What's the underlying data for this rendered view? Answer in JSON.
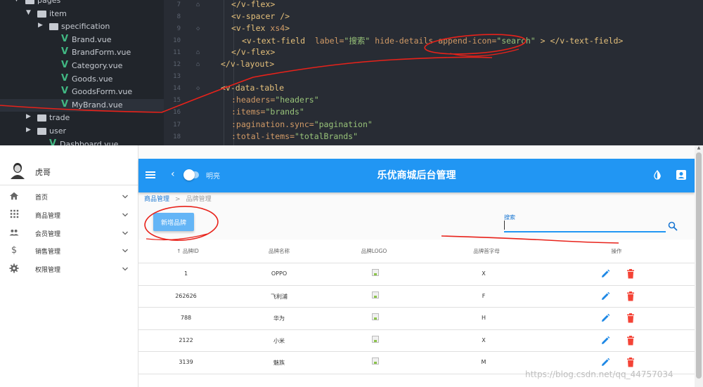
{
  "ide": {
    "tree": [
      {
        "type": "folder",
        "label": "pages",
        "open": true,
        "level": 0
      },
      {
        "type": "folder",
        "label": "item",
        "open": true,
        "level": 1
      },
      {
        "type": "folder",
        "label": "specification",
        "open": false,
        "level": 2
      },
      {
        "type": "file",
        "label": "Brand.vue",
        "level": 2
      },
      {
        "type": "file",
        "label": "BrandForm.vue",
        "level": 2
      },
      {
        "type": "file",
        "label": "Category.vue",
        "level": 2
      },
      {
        "type": "file",
        "label": "Goods.vue",
        "level": 2
      },
      {
        "type": "file",
        "label": "GoodsForm.vue",
        "level": 2
      },
      {
        "type": "file",
        "label": "MyBrand.vue",
        "level": 2,
        "selected": true
      },
      {
        "type": "folder",
        "label": "trade",
        "open": false,
        "level": 1
      },
      {
        "type": "folder",
        "label": "user",
        "open": false,
        "level": 1
      },
      {
        "type": "file",
        "label": "Dashboard.vue",
        "level": 1
      }
    ],
    "line_numbers": [
      "7",
      "8",
      "9",
      "10",
      "11",
      "12",
      "13",
      "14",
      "15",
      "16",
      "17",
      "18"
    ],
    "code": [
      {
        "indent": 1,
        "tokens": [
          [
            "tag",
            "</v-flex>"
          ]
        ]
      },
      {
        "indent": 1,
        "tokens": [
          [
            "tag",
            "<v-spacer />"
          ]
        ]
      },
      {
        "indent": 1,
        "tokens": [
          [
            "tag",
            "<v-flex"
          ],
          [
            "attr",
            " xs4"
          ],
          [
            "tag",
            ">"
          ]
        ]
      },
      {
        "indent": 2,
        "tokens": [
          [
            "tag",
            "<v-text-field"
          ],
          [
            "attr",
            "  label="
          ],
          [
            "str",
            "\"搜索\""
          ],
          [
            "attr",
            " hide-details append-icon="
          ],
          [
            "str",
            "\"search\""
          ],
          [
            "tag",
            " > </v-text-field>"
          ]
        ]
      },
      {
        "indent": 1,
        "tokens": [
          [
            "tag",
            "</v-flex>"
          ]
        ]
      },
      {
        "indent": 0,
        "tokens": [
          [
            "tag",
            "</v-layout>"
          ]
        ]
      },
      {
        "indent": 0,
        "tokens": []
      },
      {
        "indent": 0,
        "tokens": [
          [
            "tag",
            "<v-data-table"
          ]
        ]
      },
      {
        "indent": 1,
        "tokens": [
          [
            "attr",
            ":headers="
          ],
          [
            "str",
            "\"headers\""
          ]
        ]
      },
      {
        "indent": 1,
        "tokens": [
          [
            "attr",
            ":items="
          ],
          [
            "str",
            "\"brands\""
          ]
        ]
      },
      {
        "indent": 1,
        "tokens": [
          [
            "attr",
            ":pagination.sync="
          ],
          [
            "str",
            "\"pagination\""
          ]
        ]
      },
      {
        "indent": 1,
        "tokens": [
          [
            "attr",
            ":total-items="
          ],
          [
            "str",
            "\"totalBrands\""
          ]
        ]
      }
    ]
  },
  "app": {
    "user_name": "虎哥",
    "nav": [
      {
        "label": "首页",
        "icon": "home-icon"
      },
      {
        "label": "商品管理",
        "icon": "apps-icon"
      },
      {
        "label": "会员管理",
        "icon": "people-icon"
      },
      {
        "label": "销售管理",
        "icon": "dollar-icon"
      },
      {
        "label": "权限管理",
        "icon": "settings-icon"
      }
    ],
    "toolbar": {
      "theme_label": "明亮",
      "title": "乐优商城后台管理"
    },
    "breadcrumb": {
      "first": "商品管理",
      "separator": ">",
      "second": "品牌管理"
    },
    "add_brand_label": "新增品牌",
    "search": {
      "label": "搜索",
      "value": ""
    },
    "table": {
      "headers": [
        "品牌ID",
        "品牌名称",
        "品牌LOGO",
        "品牌首字母",
        "操作"
      ],
      "sort_indicator": "↑",
      "rows": [
        {
          "id": "1",
          "name": "OPPO",
          "letter": "X"
        },
        {
          "id": "262626",
          "name": "飞利浦",
          "letter": "F"
        },
        {
          "id": "788",
          "name": "华为",
          "letter": "H"
        },
        {
          "id": "2122",
          "name": "小米",
          "letter": "X"
        },
        {
          "id": "3139",
          "name": "魅族",
          "letter": "M"
        }
      ]
    },
    "colors": {
      "primary": "#2196f3",
      "edit": "#1e88e5",
      "delete": "#f44336",
      "annotation": "#e8221a"
    },
    "watermark": "https://blog.csdn.net/qq_44757034"
  }
}
